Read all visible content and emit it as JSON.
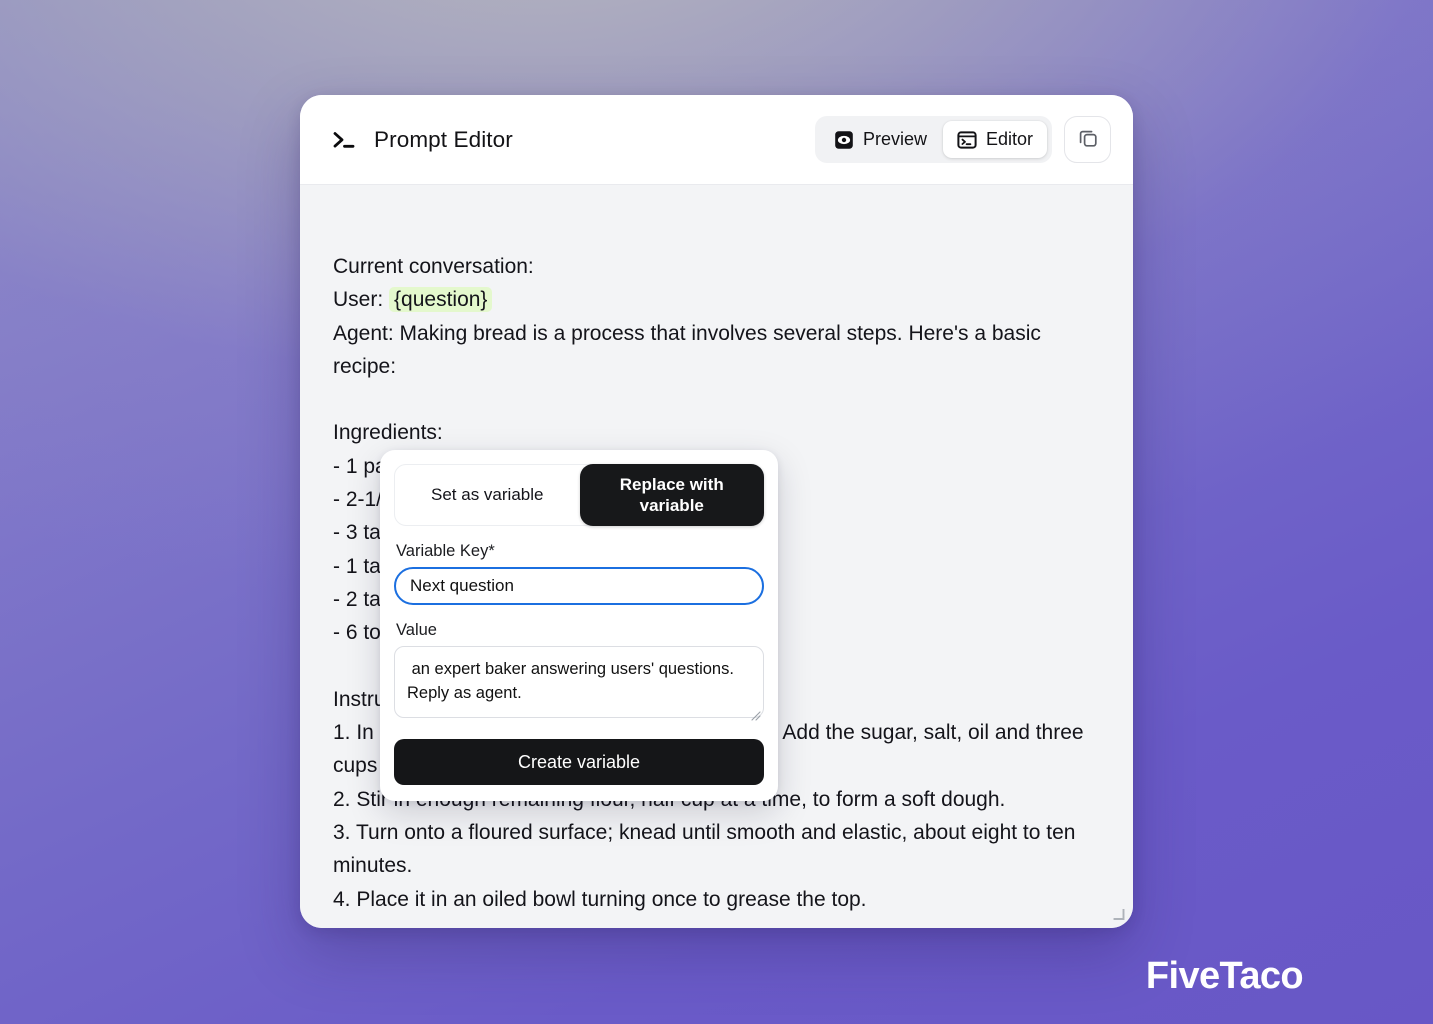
{
  "header": {
    "title": "Prompt Editor",
    "terminal_icon": "terminal-prompt-icon",
    "preview_label": "Preview",
    "editor_label": "Editor",
    "active_tab": "Editor",
    "copy_icon": "copy-icon"
  },
  "prompt": {
    "line_intro": "Current conversation:",
    "line_user_prefix": "User: ",
    "variable_chip": "{question}",
    "line_agent": "Agent: Making bread is a process that involves several steps. Here's a basic recipe:",
    "blank_1": "",
    "ingredients_heading": "Ingredients:",
    "ingredients": [
      "- 1 package active dry yeast",
      "- 2-1/4 cups warm water",
      "- 3 tablespoons sugar",
      "- 1 tablespoon salt",
      "- 2 tablespoons canola oil",
      "- 6 to 6-1/2 cups bread flour"
    ],
    "blank_2": "",
    "instructions_heading": "Instructions:",
    "instructions": [
      "1. In a large bowl, dissolve yeast in warm water. Add the sugar, salt, oil and three cups of flour. Beat until smooth.",
      "2. Stir in enough remaining flour, half cup at a time, to form a soft dough.",
      "3. Turn onto a floured surface; knead until smooth and elastic, about eight to ten minutes.",
      "4. Place it in an oiled bowl turning once to grease the top."
    ]
  },
  "popover": {
    "mode_set_label": "Set as variable",
    "mode_replace_label": "Replace with variable",
    "active_mode": "Replace with variable",
    "key_label": "Variable Key*",
    "key_value": "Next question",
    "key_placeholder": "Variable Key",
    "value_label": "Value",
    "value_value": " an expert baker answering users' questions. Reply as agent.",
    "value_placeholder": "Value",
    "submit_label": "Create variable"
  },
  "watermark": {
    "text": "FiveTaco"
  },
  "colors": {
    "accent_focus": "#1b6fe0",
    "chip_highlight": "#e4f8cd",
    "dark_button": "#151618",
    "canvas_bg": "#f3f4f6",
    "page_purple": "#6a5bc8"
  }
}
